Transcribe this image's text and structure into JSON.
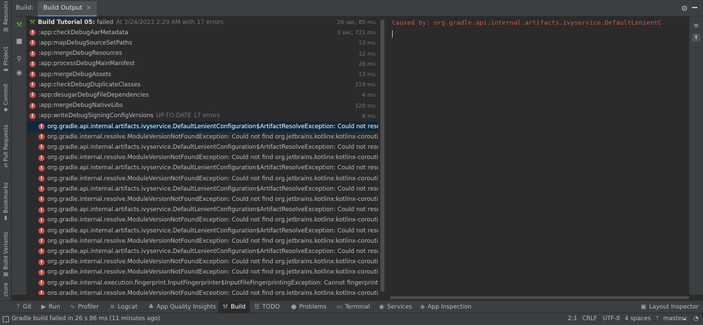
{
  "left_tool_strip": [
    {
      "label": "Resource Manager",
      "icon": "resource-icon"
    },
    {
      "label": "Project",
      "icon": "folder-icon"
    },
    {
      "label": "Commit",
      "icon": "commit-icon"
    },
    {
      "label": "Pull Requests",
      "icon": "pull-request-icon"
    },
    {
      "label": "Bookmarks",
      "icon": "bookmark-icon"
    },
    {
      "label": "Build Variants",
      "icon": "build-variants-icon"
    },
    {
      "label": "cture",
      "icon": "structure-icon"
    }
  ],
  "topbar": {
    "build_label": "Build:",
    "tab_label": "Build Output",
    "close_glyph": "×"
  },
  "tree": {
    "header": {
      "title": "Build Tutorial 05:",
      "status": "failed",
      "meta": "At 3/24/2023 2:29 AM with 17 errors",
      "time": "26 sec, 85 ms"
    },
    "tasks": [
      {
        "name": ":app:checkDebugAarMetadata",
        "time": "3 sec, 721 ms"
      },
      {
        "name": ":app:mapDebugSourceSetPaths",
        "time": "13 ms"
      },
      {
        "name": ":app:mergeDebugResources",
        "time": "12 ms"
      },
      {
        "name": ":app:processDebugMainManifest",
        "time": "26 ms"
      },
      {
        "name": ":app:mergeDebugAssets",
        "time": "13 ms"
      },
      {
        "name": ":app:checkDebugDuplicateClasses",
        "time": "219 ms"
      },
      {
        "name": ":app:desugarDebugFileDependencies",
        "time": "4 ms"
      },
      {
        "name": ":app:mergeDebugNativeLibs",
        "time": "128 ms"
      },
      {
        "name": ":app:writeDebugSigningConfigVersions",
        "meta": "UP-TO-DATE 17 errors",
        "time": "8 ms"
      }
    ],
    "errors": [
      "org.gradle.api.internal.artifacts.ivyservice.DefaultLenientConfiguration$ArtifactResolveException: Could not resolve all fil",
      "org.gradle.internal.resolve.ModuleVersionNotFoundException: Could not find org.jetbrains.kotlinx:kotlinx-coroutines□ar",
      "org.gradle.api.internal.artifacts.ivyservice.DefaultLenientConfiguration$ArtifactResolveException: Could not resolve all fil",
      "org.gradle.internal.resolve.ModuleVersionNotFoundException: Could not find org.jetbrains.kotlinx:kotlinx-coroutines□ar",
      "org.gradle.api.internal.artifacts.ivyservice.DefaultLenientConfiguration$ArtifactResolveException: Could not resolve all fil",
      "org.gradle.internal.resolve.ModuleVersionNotFoundException: Could not find org.jetbrains.kotlinx:kotlinx-coroutines□ar",
      "org.gradle.api.internal.artifacts.ivyservice.DefaultLenientConfiguration$ArtifactResolveException: Could not resolve all fil",
      "org.gradle.internal.resolve.ModuleVersionNotFoundException: Could not find org.jetbrains.kotlinx:kotlinx-coroutines□ar",
      "org.gradle.api.internal.artifacts.ivyservice.DefaultLenientConfiguration$ArtifactResolveException: Could not resolve all fil",
      "org.gradle.internal.resolve.ModuleVersionNotFoundException: Could not find org.jetbrains.kotlinx:kotlinx-coroutines□ar",
      "org.gradle.api.internal.artifacts.ivyservice.DefaultLenientConfiguration$ArtifactResolveException: Could not resolve all fil",
      "org.gradle.internal.resolve.ModuleVersionNotFoundException: Could not find org.jetbrains.kotlinx:kotlinx-coroutines□ar",
      "org.gradle.api.internal.artifacts.ivyservice.DefaultLenientConfiguration$ArtifactResolveException: Could not resolve all fil",
      "org.gradle.internal.resolve.ModuleVersionNotFoundException: Could not find org.jetbrains.kotlinx:kotlinx-coroutines□ar",
      "org.gradle.internal.resolve.ModuleVersionNotFoundException: Could not find org.jetbrains.kotlinx:kotlinx-coroutines□ar",
      "org.gradle.internal.execution.fingerprint.InputFingerprinter$InputFileFingerprintingException: Cannot fingerprint input fi",
      "org.gradle.internal.resolve.ModuleVersionNotFoundException: Could not find org.jetbrains.kotlinx:kotlinx-coroutines□ar"
    ]
  },
  "console": {
    "line": "Caused by: org.gradle.api.internal.artifacts.ivyservice.DefaultLenientC"
  },
  "bottom_tabs": [
    {
      "label": "Git",
      "icon": "git-icon"
    },
    {
      "label": "Run",
      "icon": "run-icon"
    },
    {
      "label": "Profiler",
      "icon": "profiler-icon"
    },
    {
      "label": "Logcat",
      "icon": "logcat-icon"
    },
    {
      "label": "App Quality Insights",
      "icon": "app-quality-icon"
    },
    {
      "label": "Build",
      "icon": "hammer-icon",
      "active": true
    },
    {
      "label": "TODO",
      "icon": "todo-icon"
    },
    {
      "label": "Problems",
      "icon": "problems-icon"
    },
    {
      "label": "Terminal",
      "icon": "terminal-icon"
    },
    {
      "label": "Services",
      "icon": "services-icon"
    },
    {
      "label": "App Inspection",
      "icon": "app-inspection-icon"
    },
    {
      "label": "Layout Inspector",
      "icon": "layout-inspector-icon"
    }
  ],
  "statusbar": {
    "message": "Gradle build failed in 26 s 86 ms (11 minutes ago)",
    "position": "2:1",
    "line_sep": "CRLF",
    "encoding": "UTF-8",
    "indent": "4 spaces",
    "branch": "master"
  },
  "colors": {
    "accent": "#4a88c7",
    "error": "#c75450",
    "selection": "#0d293e",
    "console_error": "#d25252"
  }
}
